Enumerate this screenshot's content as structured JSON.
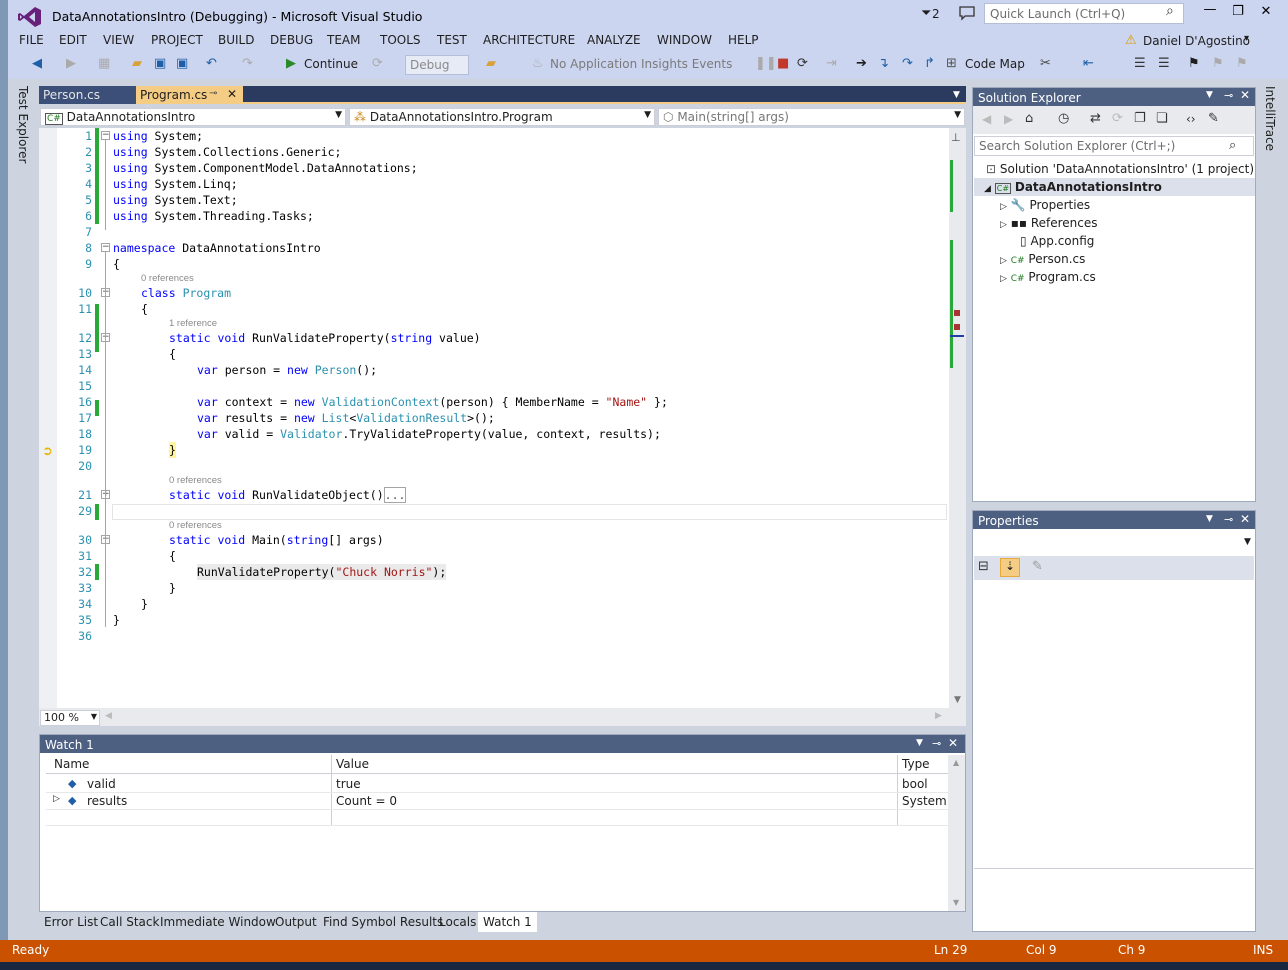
{
  "window": {
    "title": "DataAnnotationsIntro (Debugging) - Microsoft Visual Studio",
    "notifications": "2",
    "quick_launch_placeholder": "Quick Launch (Ctrl+Q)"
  },
  "menu": [
    "FILE",
    "EDIT",
    "VIEW",
    "PROJECT",
    "BUILD",
    "DEBUG",
    "TEAM",
    "TOOLS",
    "TEST",
    "ARCHITECTURE",
    "ANALYZE",
    "WINDOW",
    "HELP"
  ],
  "user": "Daniel D'Agostino",
  "toolbar": {
    "continue": "Continue",
    "config": "Debug",
    "insights": "No Application Insights Events",
    "codemap": "Code Map"
  },
  "side_tabs": {
    "left": "Test Explorer",
    "right": "IntelliTrace"
  },
  "doc_tabs": [
    "Person.cs",
    "Program.cs"
  ],
  "nav": {
    "project": "DataAnnotationsIntro",
    "type": "DataAnnotationsIntro.Program",
    "member": "Main(string[] args)"
  },
  "zoom": "100 %",
  "lenses": {
    "r0": "0 references",
    "r1": "1 reference",
    "r2": "0 references",
    "r3": "0 references"
  },
  "line_numbers": [
    "1",
    "2",
    "3",
    "4",
    "5",
    "6",
    "7",
    "8",
    "9",
    "10",
    "11",
    "12",
    "13",
    "14",
    "15",
    "16",
    "17",
    "18",
    "19",
    "20",
    "21",
    "29",
    "30",
    "31",
    "32",
    "33",
    "34",
    "35",
    "36"
  ],
  "code": {
    "l1a": "using",
    "l1b": " System;",
    "l2a": "using",
    "l2b": " System.Collections.Generic;",
    "l3a": "using",
    "l3b": " System.ComponentModel.DataAnnotations;",
    "l4a": "using",
    "l4b": " System.Linq;",
    "l5a": "using",
    "l5b": " System.Text;",
    "l6a": "using",
    "l6b": " System.Threading.Tasks;",
    "l8a": "namespace",
    "l8b": " DataAnnotationsIntro",
    "brace_open": "{",
    "brace_close": "}",
    "l10a": "class",
    "l10b": "Program",
    "l12a": "static void",
    "l12b": " RunValidateProperty(",
    "l12c": "string",
    "l12d": " value)",
    "l14a": "var",
    "l14b": " person = ",
    "l14c": "new",
    "l14d": "Person",
    "l14e": "();",
    "l16a": "var",
    "l16b": " context = ",
    "l16c": "new",
    "l16d": "ValidationContext",
    "l16e": "(person) { MemberName = ",
    "l16f": "\"Name\"",
    "l16g": " };",
    "l17a": "var",
    "l17b": " results = ",
    "l17c": "new",
    "l17d": "List",
    "l17e": "<",
    "l17f": "ValidationResult",
    "l17g": ">();",
    "l18a": "var",
    "l18b": " valid = ",
    "l18c": "Validator",
    "l18d": ".TryValidateProperty(value, context, results);",
    "l21a": "static void",
    "l21b": " RunValidateObject()",
    "l21c": "...",
    "l30a": "static void",
    "l30b": " Main(",
    "l30c": "string",
    "l30d": "[] args)",
    "l32a": "RunValidateProperty(",
    "l32b": "\"Chuck Norris\"",
    "l32c": ");"
  },
  "solution_explorer": {
    "title": "Solution Explorer",
    "search_placeholder": "Search Solution Explorer (Ctrl+;)",
    "solution": "Solution 'DataAnnotationsIntro' (1 project)",
    "project": "DataAnnotationsIntro",
    "items": [
      "Properties",
      "References",
      "App.config",
      "Person.cs",
      "Program.cs"
    ]
  },
  "properties": {
    "title": "Properties"
  },
  "watch": {
    "title": "Watch 1",
    "columns": [
      "Name",
      "Value",
      "Type"
    ],
    "rows": [
      {
        "name": "valid",
        "value": "true",
        "type": "bool"
      },
      {
        "name": "results",
        "value": "Count = 0",
        "type": "System.C"
      }
    ]
  },
  "bottom_tabs": [
    "Error List",
    "Call Stack",
    "Immediate Window",
    "Output",
    "Find Symbol Results",
    "Locals",
    "Watch 1"
  ],
  "status": {
    "ready": "Ready",
    "ln": "Ln 29",
    "col": "Col 9",
    "ch": "Ch 9",
    "ins": "INS"
  },
  "colors": {
    "accent": "#68217a",
    "status_bar": "#ca5100",
    "tab_active": "#f5cc84",
    "panel_header": "#4d6082"
  }
}
